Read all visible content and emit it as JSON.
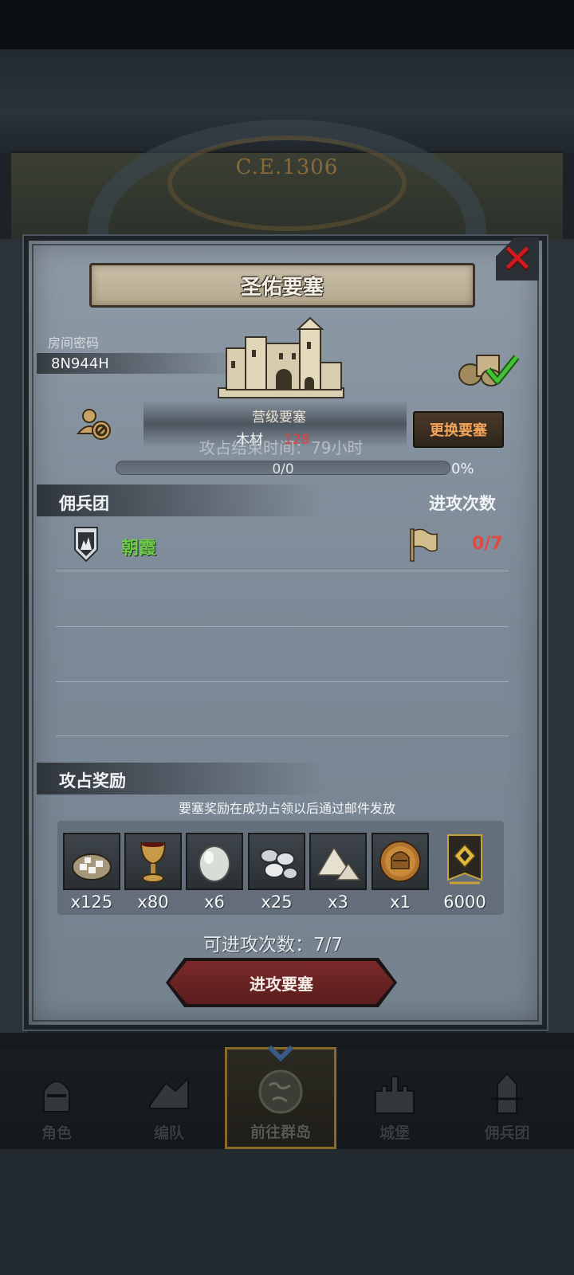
{
  "background": {
    "year_label": "C.E.1306"
  },
  "dialog": {
    "title": "圣佑要塞",
    "close_icon": "close-x-icon",
    "room_code_label": "房间密码",
    "room_code_value": "8N944H",
    "fortress_level": "营级要塞",
    "resource_label": "木材",
    "resource_value": "128",
    "attack_time_text": "攻占结束时间：79小时",
    "change_fortress_label": "更换要塞",
    "progress": {
      "count_text": "0/0",
      "percent_text": "0%",
      "fraction": 0
    },
    "mercenary_header": "佣兵团",
    "attack_count_header": "进攻次数",
    "guilds": [
      {
        "name": "朝霞",
        "attacks": "0/7"
      }
    ],
    "reward_header": "攻占奖励",
    "reward_note": "要塞奖励在成功占领以后通过邮件发放",
    "rewards": [
      {
        "icon": "ore-sack-icon",
        "qty": "x125"
      },
      {
        "icon": "goblet-icon",
        "qty": "x80"
      },
      {
        "icon": "pearl-icon",
        "qty": "x6"
      },
      {
        "icon": "silver-coins-icon",
        "qty": "x25"
      },
      {
        "icon": "salt-pile-icon",
        "qty": "x3"
      },
      {
        "icon": "knight-medal-icon",
        "qty": "x1"
      },
      {
        "icon": "rank-banner-icon",
        "qty": "6000"
      }
    ],
    "attack_remaining_text": "可进攻次数：7/7",
    "attack_button_label": "进攻要塞"
  },
  "nav": {
    "items": [
      {
        "label": "角色",
        "icon": "knight-helmet-icon"
      },
      {
        "label": "编队",
        "icon": "formation-icon"
      },
      {
        "label": "前往群岛",
        "icon": "globe-icon"
      },
      {
        "label": "城堡",
        "icon": "castle-icon"
      },
      {
        "label": "佣兵团",
        "icon": "mercenary-icon"
      }
    ]
  },
  "colors": {
    "accent_gold": "#c28f3a",
    "guild_green": "#6ecb4a",
    "alert_red": "#e04a42",
    "button_orange": "#f2a45a"
  }
}
